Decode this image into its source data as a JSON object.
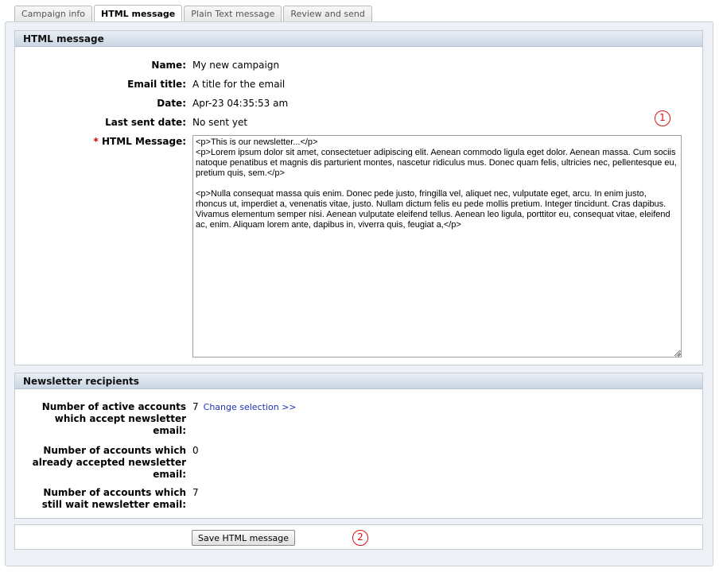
{
  "tabs": [
    {
      "label": "Campaign info",
      "active": false
    },
    {
      "label": "HTML message",
      "active": true
    },
    {
      "label": "Plain Text message",
      "active": false
    },
    {
      "label": "Review and send",
      "active": false
    }
  ],
  "html_section": {
    "title": "HTML message",
    "name_label": "Name:",
    "name_value": "My new campaign",
    "email_title_label": "Email title:",
    "email_title_value": "A title for the email",
    "date_label": "Date:",
    "date_value": "Apr-23 04:35:53 am",
    "last_sent_label": "Last sent date:",
    "last_sent_value": "No sent yet",
    "required_mark": "*",
    "message_label": "HTML Message:",
    "message_value": "<p>This is our newsletter...</p>\n<p>Lorem ipsum dolor sit amet, consectetuer adipiscing elit. Aenean commodo ligula eget dolor. Aenean massa. Cum sociis natoque penatibus et magnis dis parturient montes, nascetur ridiculus mus. Donec quam felis, ultricies nec, pellentesque eu, pretium quis, sem.</p>\n\n<p>Nulla consequat massa quis enim. Donec pede justo, fringilla vel, aliquet nec, vulputate eget, arcu. In enim justo, rhoncus ut, imperdiet a, venenatis vitae, justo. Nullam dictum felis eu pede mollis pretium. Integer tincidunt. Cras dapibus. Vivamus elementum semper nisi. Aenean vulputate eleifend tellus. Aenean leo ligula, porttitor eu, consequat vitae, eleifend ac, enim. Aliquam lorem ante, dapibus in, viverra quis, feugiat a,</p>"
  },
  "recipients_section": {
    "title": "Newsletter recipients",
    "active_label": "Number of active accounts which accept newsletter email:",
    "active_value": "7",
    "change_link": "Change selection >>",
    "accepted_label": "Number of accounts which already accepted newsletter email:",
    "accepted_value": "0",
    "waiting_label": "Number of accounts which still wait newsletter email:",
    "waiting_value": "7"
  },
  "save_section": {
    "save_label": "Save HTML message"
  },
  "markers": {
    "one": "1",
    "two": "2"
  },
  "colors": {
    "required": "#cc0000",
    "link": "#1a33b3",
    "marker": "#dd1111",
    "section_header": "#c9d6e3"
  }
}
